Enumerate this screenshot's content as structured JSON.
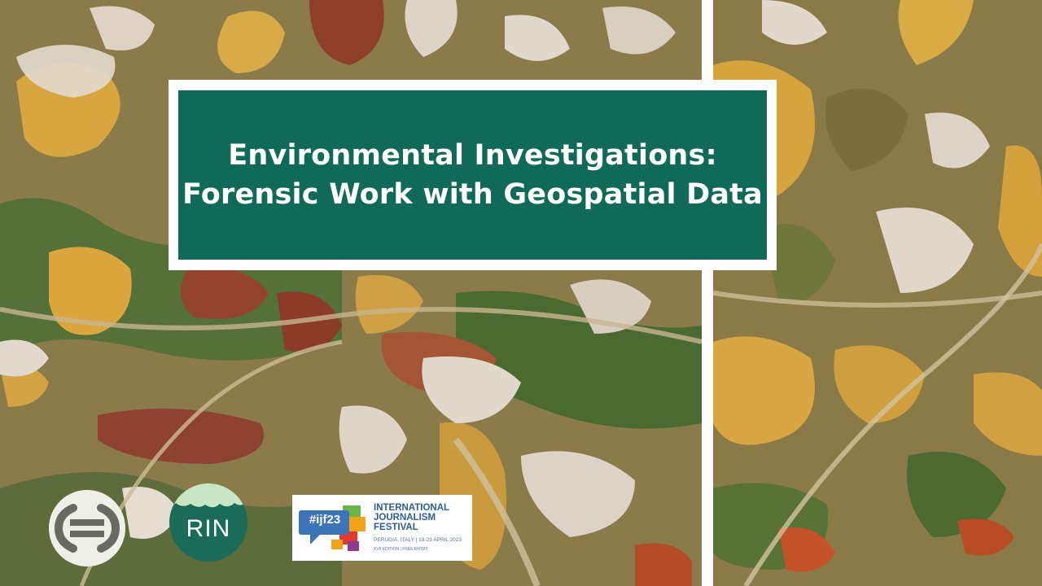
{
  "scene": {
    "description_colors": {
      "water_ochre": "#d7a640",
      "water_rust": "#8d3f2c",
      "sand": "#ddd2c4",
      "vegetation": "#4f6a32",
      "title_green": "#116957",
      "frame_white": "#ffffff"
    }
  },
  "title": {
    "line1": "Environmental Investigations:",
    "line2": "Forensic Work with Geospatial Data"
  },
  "logos": {
    "oc_icon": "oc-logo-icon",
    "rin": {
      "text": "RIN",
      "color": "#1a6b58"
    },
    "ijf": {
      "hashtag": "#ijf23",
      "name_line1": "INTERNATIONAL",
      "name_line2": "JOURNALISM",
      "name_line3": "FESTIVAL",
      "date": "PERUGIA, ITALY | 19-23 APRIL 2023",
      "edition": "XVII EDITION | FREE ENTRY",
      "color": "#2d5e95"
    }
  }
}
